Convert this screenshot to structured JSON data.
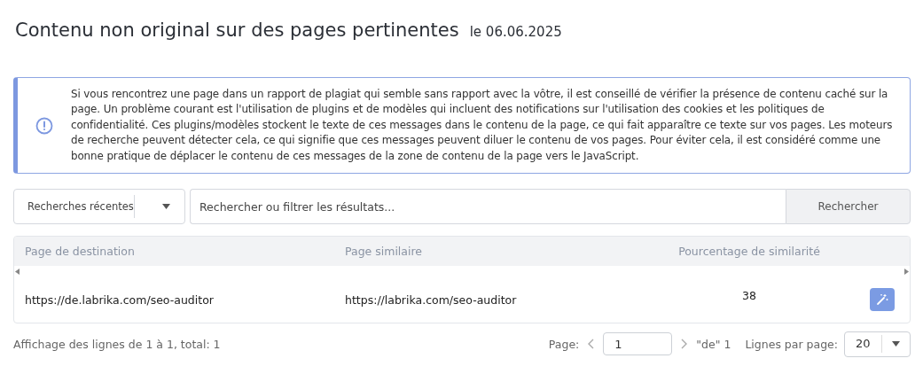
{
  "header": {
    "title": "Contenu non original sur des pages pertinentes",
    "date": "le 06.06.2025"
  },
  "notice": {
    "text": "Si vous rencontrez une page dans un rapport de plagiat qui semble sans rapport avec la vôtre, il est conseillé de vérifier la présence de contenu caché sur la page. Un problème courant est l'utilisation de plugins et de modèles qui incluent des notifications sur l'utilisation des cookies et les politiques de confidentialité. Ces plugins/modèles stockent le texte de ces messages dans le contenu de la page, ce qui fait apparaître ce texte sur vos pages. Les moteurs de recherche peuvent détecter cela, ce qui signifie que ces messages peuvent diluer le contenu de vos pages. Pour éviter cela, il est considéré comme une bonne pratique de déplacer le contenu de ces messages de la zone de contenu de la page vers le JavaScript."
  },
  "search": {
    "recent_label": "Recherches récentes",
    "placeholder": "Rechercher ou filtrer les résultats...",
    "button": "Rechercher"
  },
  "table": {
    "columns": [
      "Page de destination",
      "Page similaire",
      "Pourcentage de similarité"
    ],
    "rows": [
      {
        "destination": "https://de.labrika.com/seo-auditor",
        "similar": "https://labrika.com/seo-auditor",
        "percent": "38"
      }
    ]
  },
  "footer": {
    "summary": "Affichage des lignes de 1 à 1, total: 1",
    "page_label": "Page:",
    "page_value": "1",
    "page_of": "\"de\" 1",
    "rows_label": "Lignes par page:",
    "rows_value": "20"
  }
}
